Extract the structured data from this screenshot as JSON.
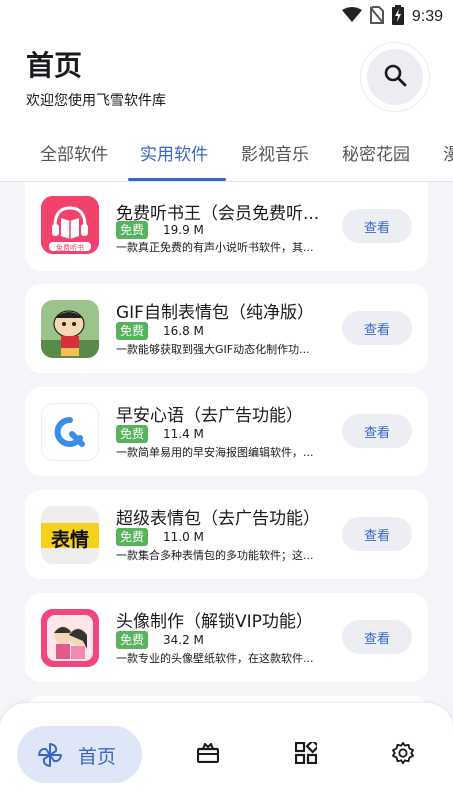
{
  "status_bar": {
    "time": "9:39",
    "icons": [
      "wifi-icon",
      "no-sim-icon",
      "battery-charging-icon"
    ]
  },
  "header": {
    "title": "首页",
    "subtitle": "欢迎您使用飞雪软件库",
    "search_icon": "search-icon"
  },
  "tabs": [
    {
      "label": "全部软件",
      "active": false
    },
    {
      "label": "实用软件",
      "active": true
    },
    {
      "label": "影视音乐",
      "active": false
    },
    {
      "label": "秘密花园",
      "active": false
    },
    {
      "label": "漫",
      "active": false
    }
  ],
  "apps": [
    {
      "name": "免费听书王（会员免费听...",
      "badge": "免费",
      "size": "19.9 M",
      "desc": "一款真正免费的有声小说听书软件，其...",
      "action": "查看",
      "icon": "headphones-book-icon",
      "icon_label": "免费听书"
    },
    {
      "name": "GIF自制表情包（纯净版）",
      "badge": "免费",
      "size": "16.8 M",
      "desc": "一款能够获取到强大GIF动态化制作功...",
      "action": "查看",
      "icon": "cartoon-character-icon"
    },
    {
      "name": "早安心语（去广告功能）",
      "badge": "免费",
      "size": "11.4 M",
      "desc": "一款简单易用的早安海报图编辑软件，...",
      "action": "查看",
      "icon": "q-logo-icon"
    },
    {
      "name": "超级表情包（去广告功能）",
      "badge": "免费",
      "size": "11.0 M",
      "desc": "一款集合多种表情包的多功能软件；这...",
      "action": "查看",
      "icon": "emoji-text-icon",
      "icon_label": "表情"
    },
    {
      "name": "头像制作（解锁VIP功能）",
      "badge": "免费",
      "size": "34.2 M",
      "desc": "一款专业的头像壁纸软件，在这款软件...",
      "action": "查看",
      "icon": "avatar-couple-icon"
    }
  ],
  "bottom_nav": {
    "home_label": "首页",
    "items": [
      "pinwheel-icon",
      "toolbox-icon",
      "grid-apps-icon",
      "gear-icon"
    ]
  },
  "colors": {
    "accent": "#3a68c8",
    "free_badge": "#57b35c",
    "background": "#f4f5f8"
  }
}
